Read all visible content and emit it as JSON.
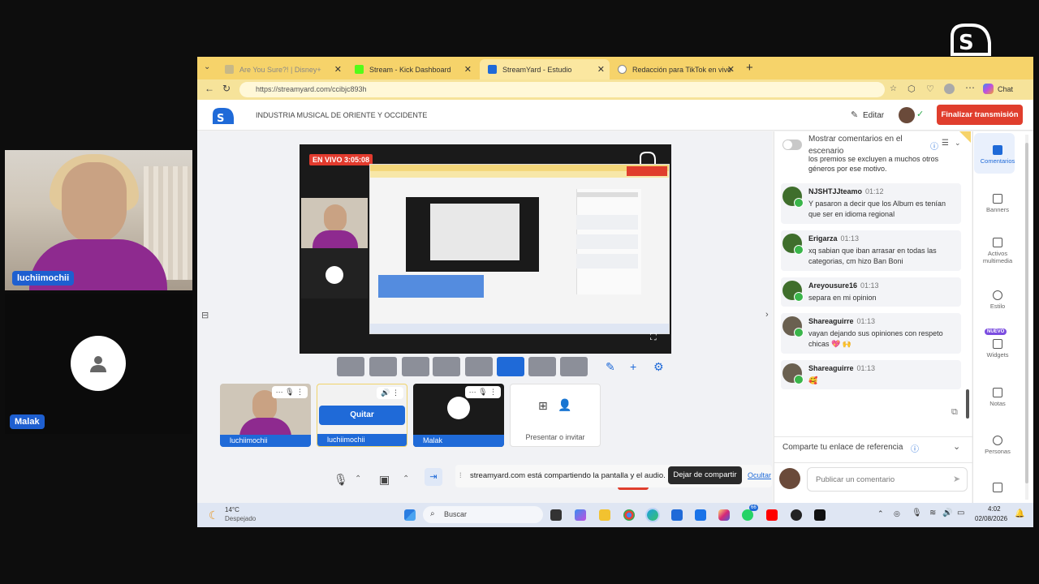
{
  "webcams": [
    {
      "name": "luchiimochii"
    },
    {
      "name": "Malak"
    }
  ],
  "brand": {
    "logo_text": "streamyard"
  },
  "browser": {
    "tabs": [
      {
        "title": "Are You Sure?! | Disney+",
        "color": "#1a3a8a"
      },
      {
        "title": "Stream - Kick Dashboard",
        "color": "#53fc18"
      },
      {
        "title": "StreamYard - Estudio",
        "color": "#1f6ad8"
      },
      {
        "title": "Redacción para TikTok en vivo",
        "color": "#6a6a6a"
      }
    ],
    "url": "https://streamyard.com/ccibjc893h",
    "chat_label": "Chat"
  },
  "header": {
    "broadcast_title": "INDUSTRIA MUSICAL DE ORIENTE Y OCCIDENTE",
    "edit_label": "Editar",
    "end_label": "Finalizar transmisión"
  },
  "stage": {
    "live_badge": "EN VIVO 3:05:08"
  },
  "sources": [
    {
      "label": "luchiimochii"
    },
    {
      "label": "luchiimochii",
      "action": "Quitar"
    },
    {
      "label": "Malak"
    }
  ],
  "invite": {
    "label": "Presentar o invitar"
  },
  "share_bar": {
    "message": "streamyard.com está compartiendo la pantalla y el audio.",
    "stop_label": "Dejar de compartir",
    "hide_label": "Ocultar"
  },
  "comments_panel": {
    "toggle_label": "Mostrar comentarios en el escenario",
    "first_text": "los premios se excluyen a muchos otros géneros por ese motivo.",
    "items": [
      {
        "author": "NJSHTJJteamo",
        "time": "01:12",
        "text": "Y pasaron a decir que los Album es tenían que ser en idioma regional"
      },
      {
        "author": "Erigarza",
        "time": "01:13",
        "text": "xq sabian que iban arrasar en todas las categorias, cm hizo Ban Boni"
      },
      {
        "author": "Areyousure16",
        "time": "01:13",
        "text": "separa en mi opinion"
      },
      {
        "author": "Shareaguirre",
        "time": "01:13",
        "text": "vayan dejando sus opiniones con respeto chicas 💖 🙌"
      },
      {
        "author": "Shareaguirre",
        "time": "01:13",
        "text": "🥰"
      }
    ],
    "referral_label": "Comparte tu enlace de referencia",
    "comment_placeholder": "Publicar un comentario"
  },
  "right_nav": [
    {
      "label": "Comentarios",
      "active": true
    },
    {
      "label": "Banners"
    },
    {
      "label": "Activos multimedia"
    },
    {
      "label": "Estilo"
    },
    {
      "label": "Widgets",
      "badge": "NUEVO"
    },
    {
      "label": "Notas"
    },
    {
      "label": "Personas"
    }
  ],
  "taskbar": {
    "weather_temp": "14°C",
    "weather_desc": "Despejado",
    "search_label": "Buscar",
    "time": "4:02",
    "date": "02/08/2026",
    "badge_count": "66"
  }
}
